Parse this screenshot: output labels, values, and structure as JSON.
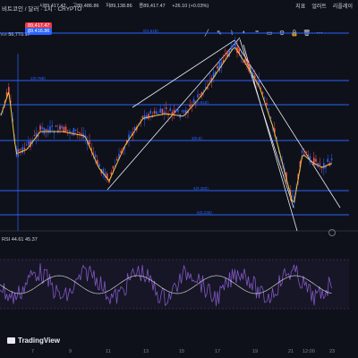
{
  "header": {
    "title": "비트코인 / 달러 · 1시 · CRYPTO",
    "ohlc": [
      "시89,417.42",
      "고89,486.86",
      "저89,138.86",
      "종89,417.47"
    ],
    "change": "+26.10 (+0.03%)",
    "price_badge": "89,417.47",
    "ask_badge": "89,416.86",
    "volume_label": "Vol",
    "volume_value": "56,770.17"
  },
  "toolbar": {
    "indicators": "지표",
    "alert": "얼러트",
    "replay": "리플레이"
  },
  "fib_labels": [
    "0(1.618)",
    "1(0.786)",
    "2(0.618)",
    "3(0.5)",
    "4(0.382)",
    "5(0.236)"
  ],
  "oscillator": {
    "label": "RSI",
    "value1": "44.61",
    "value2": "45.37"
  },
  "x_axis": [
    "7",
    "9",
    "11",
    "13",
    "15",
    "17",
    "19",
    "21",
    "12:00",
    "23"
  ],
  "brand": "TradingView",
  "colors": {
    "background": "#0f111a",
    "up": "#ef5350",
    "down": "#2962ff",
    "ma": "#f5c542",
    "fib": "#2962ff",
    "rsi": "#7e57c2"
  }
}
